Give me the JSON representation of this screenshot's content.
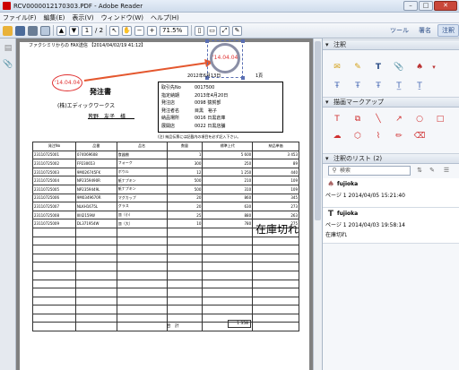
{
  "titlebar": {
    "title": "RCV0000012170303.PDF - Adobe Reader",
    "min": "–",
    "max": "□",
    "close": "✕"
  },
  "menu": [
    "ファイル(F)",
    "編集(E)",
    "表示(V)",
    "ウィンドウ(W)",
    "ヘルプ(H)"
  ],
  "toolbar": {
    "page_current": "1",
    "page_total": "/ 2",
    "zoom": "71.5%",
    "tools_label": "ツール",
    "sign_label": "署名",
    "comment_label": "注釈"
  },
  "doc": {
    "fax_header": "ファクシミリからの FAX送信 【2014/04/02/19 41:12】",
    "stamp_date": "'14.04.04",
    "stamp_date2": "'14.04.04",
    "issue_date": "2012年6月13日",
    "page_label": "1頁",
    "title": "発注書",
    "company": "(株)エディックワークス",
    "person": "皆野　友子　様",
    "info_rows": [
      [
        "取引先No",
        "0017500"
      ],
      [
        "指定納期",
        "2013年4月20日"
      ],
      [
        "発注店",
        "0098 猿賀部"
      ],
      [
        "発注者名",
        "目黒　裕子"
      ],
      [
        "納品場所",
        "0016 日黒倉庫"
      ],
      [
        "展開店",
        "0022 日黒店舗"
      ]
    ],
    "note": "(注) 納品伝票には記載内の項目を必ず記入下さい。",
    "table_header": [
      "発注No",
      "品番",
      "品名",
      "数量",
      "標準上代",
      "納品単価"
    ],
    "table_rows": [
      [
        "23110725001",
        "074069608",
        "食器棚",
        "1",
        "5 600",
        "3 453"
      ],
      [
        "23110725002",
        "FP230653",
        "フォーク",
        "300",
        "250",
        "89"
      ],
      [
        "23110725003",
        "9M026745FK",
        "ボウル",
        "12",
        "1 250",
        "440"
      ],
      [
        "23110725004",
        "NP2359490R",
        "紙ナプキン",
        "500",
        "210",
        "109"
      ],
      [
        "23110725005",
        "NP2359449L",
        "紙ナプキン",
        "500",
        "310",
        "109"
      ],
      [
        "23110725006",
        "9M0349670R",
        "マグカップ",
        "20",
        "860",
        "345"
      ],
      [
        "23110725007",
        "NLKH1675L",
        "グラス",
        "20",
        "630",
        "273"
      ],
      [
        "23110725008",
        "IIIII2159W",
        "皿（小）",
        "25",
        "880",
        "263"
      ],
      [
        "23110725009",
        "DL371954W",
        "皿（大）",
        "10",
        "780",
        "275"
      ],
      [
        "",
        "",
        "",
        "",
        "",
        ""
      ],
      [
        "",
        "",
        "",
        "",
        "",
        ""
      ],
      [
        "",
        "",
        "",
        "",
        "",
        ""
      ],
      [
        "",
        "",
        "",
        "",
        "",
        ""
      ],
      [
        "",
        "",
        "",
        "",
        "",
        ""
      ],
      [
        "",
        "",
        "",
        "",
        "",
        ""
      ],
      [
        "",
        "",
        "",
        "",
        "",
        ""
      ],
      [
        "",
        "",
        "",
        "",
        "",
        ""
      ],
      [
        "",
        "",
        "",
        "",
        "",
        ""
      ],
      [
        "",
        "",
        "",
        "",
        "",
        ""
      ],
      [
        "",
        "",
        "",
        "",
        "",
        ""
      ],
      [
        "",
        "",
        "",
        "",
        "",
        ""
      ]
    ],
    "total_label": "合　計",
    "total_value": "1 358",
    "annotation_text": "在庫切れ"
  },
  "rightpane": {
    "section_comment": "注釈",
    "section_draw": "描画マークアップ",
    "section_list": "注釈のリスト (2)",
    "search_placeholder": "検索",
    "comments": [
      {
        "author": "fujioka",
        "meta": "ページ 1 2014/04/05 15:21:40",
        "body": ""
      },
      {
        "author": "fujioka",
        "meta": "ページ 1 2014/04/03 19:58:14",
        "body": "在庫切れ"
      }
    ]
  }
}
